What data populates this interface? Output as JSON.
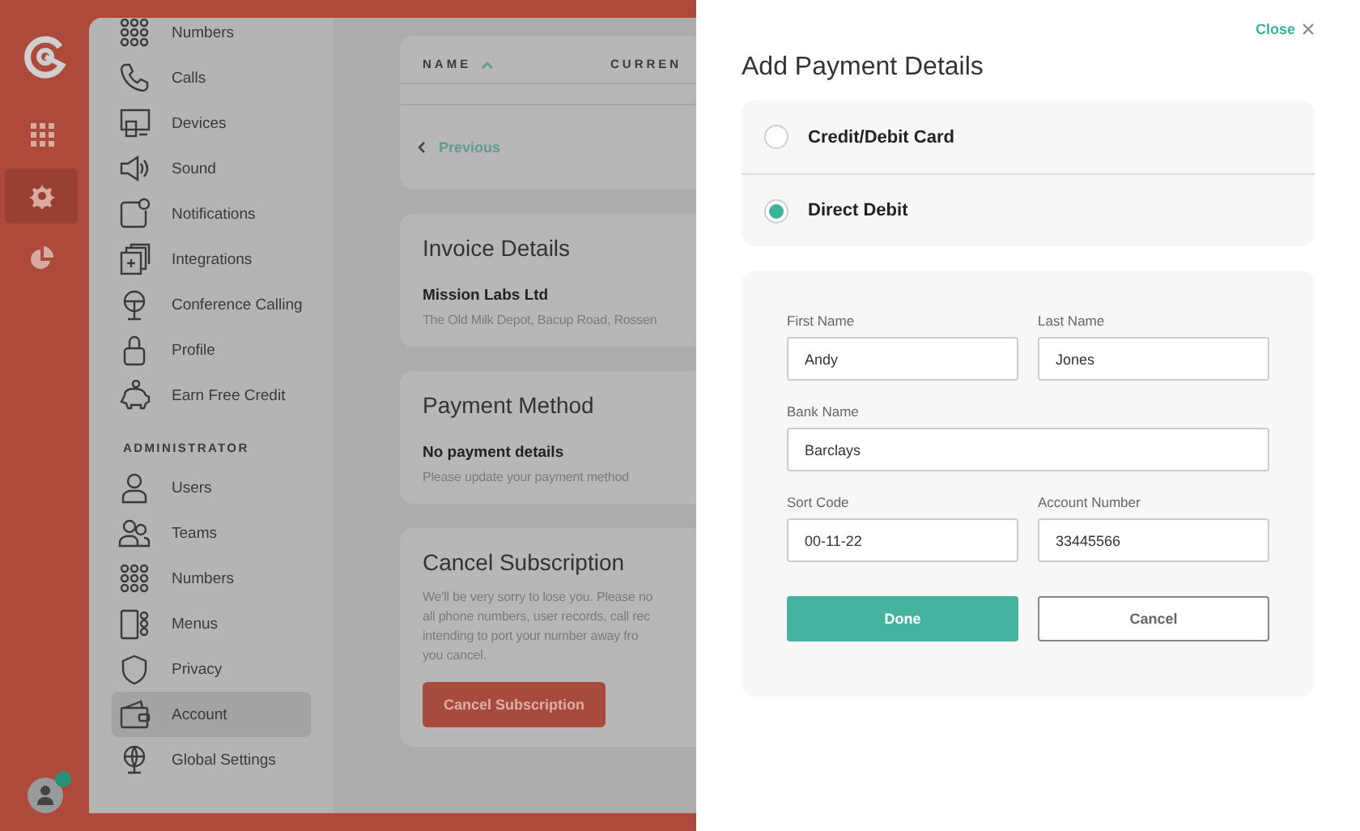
{
  "rail": {
    "items": [
      {
        "kind": "apps",
        "selected": false
      },
      {
        "kind": "settings",
        "selected": true
      },
      {
        "kind": "reports",
        "selected": false
      }
    ]
  },
  "menu": {
    "sections": [
      {
        "items": [
          {
            "label": "Numbers",
            "kind": "numbers",
            "selected": false
          },
          {
            "label": "Calls",
            "kind": "phone",
            "selected": false
          },
          {
            "label": "Devices",
            "kind": "devices",
            "selected": false
          },
          {
            "label": "Sound",
            "kind": "sound",
            "selected": false
          },
          {
            "label": "Notifications",
            "kind": "notifications",
            "selected": false
          },
          {
            "label": "Integrations",
            "kind": "integrations",
            "selected": false
          },
          {
            "label": "Conference Calling",
            "kind": "conference",
            "selected": false
          },
          {
            "label": "Profile",
            "kind": "lock",
            "selected": false
          },
          {
            "label": "Earn Free Credit",
            "kind": "piggy",
            "selected": false
          }
        ]
      },
      {
        "heading": "ADMINISTRATOR",
        "items": [
          {
            "label": "Users",
            "kind": "user",
            "selected": false
          },
          {
            "label": "Teams",
            "kind": "users",
            "selected": false
          },
          {
            "label": "Numbers",
            "kind": "numbers",
            "selected": false
          },
          {
            "label": "Menus",
            "kind": "menus",
            "selected": false
          },
          {
            "label": "Privacy",
            "kind": "shield",
            "selected": false
          },
          {
            "label": "Account",
            "kind": "wallet",
            "selected": true
          },
          {
            "label": "Global Settings",
            "kind": "globe",
            "selected": false
          }
        ]
      }
    ]
  },
  "main": {
    "table": {
      "columns": [
        {
          "label": "NAME",
          "sorted": true
        },
        {
          "label": "CURREN",
          "sorted": false
        }
      ],
      "pager": "Previous"
    },
    "invoice": {
      "title": "Invoice Details",
      "company": "Mission Labs Ltd",
      "address": "The Old Milk Depot, Bacup Road, Rossen"
    },
    "payment": {
      "title": "Payment Method",
      "status": "No payment details",
      "hint": "Please update your payment method"
    },
    "cancel": {
      "title": "Cancel Subscription",
      "lines": [
        "We'll be very sorry to lose you. Please no",
        "all phone numbers, user records, call rec",
        "intending to port your number away fro",
        "you cancel."
      ],
      "button": "Cancel Subscription"
    }
  },
  "drawer": {
    "close": "Close",
    "title": "Add Payment Details",
    "options": [
      {
        "label": "Credit/Debit Card",
        "selected": false
      },
      {
        "label": "Direct Debit",
        "selected": true
      }
    ],
    "rows": [
      [
        {
          "label": "First Name",
          "value": "Andy"
        },
        {
          "label": "Last Name",
          "value": "Jones"
        }
      ],
      [
        {
          "label": "Bank Name",
          "value": "Barclays"
        }
      ],
      [
        {
          "label": "Sort Code",
          "value": "00-11-22"
        },
        {
          "label": "Account Number",
          "value": "33445566"
        }
      ]
    ],
    "buttons": [
      {
        "label": "Done",
        "kind": "primary"
      },
      {
        "label": "Cancel",
        "kind": "secondary"
      }
    ]
  }
}
